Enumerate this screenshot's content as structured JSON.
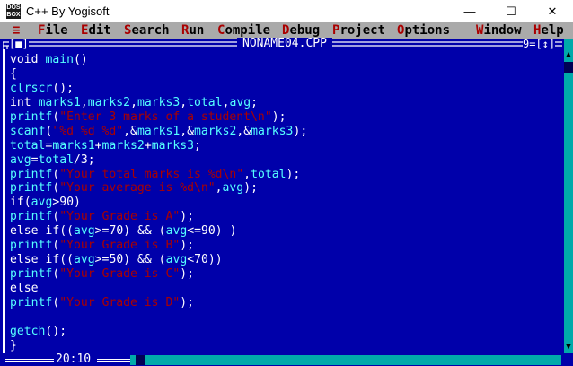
{
  "window": {
    "title": "C++ By Yogisoft",
    "icon_text": "DOS BOX",
    "minimize": "—",
    "maximize": "☐",
    "close": "✕"
  },
  "menu": {
    "system": "≡",
    "items": [
      {
        "label": "File",
        "hotkey": "F",
        "rest": "ile"
      },
      {
        "label": "Edit",
        "hotkey": "E",
        "rest": "dit"
      },
      {
        "label": "Search",
        "hotkey": "S",
        "rest": "earch"
      },
      {
        "label": "Run",
        "hotkey": "R",
        "rest": "un"
      },
      {
        "label": "Compile",
        "hotkey": "C",
        "rest": "ompile"
      },
      {
        "label": "Debug",
        "hotkey": "D",
        "rest": "ebug"
      },
      {
        "label": "Project",
        "hotkey": "P",
        "rest": "roject"
      },
      {
        "label": "Options",
        "hotkey": "O",
        "rest": "ptions"
      },
      {
        "label": "Window",
        "hotkey": "W",
        "rest": "indow"
      },
      {
        "label": "Help",
        "hotkey": "H",
        "rest": "elp"
      }
    ]
  },
  "editor": {
    "filename": "NONAME04.CPP",
    "close_box": "[■]",
    "window_number": "9",
    "zoom_box": "[↕]",
    "cursor_position": "20:10",
    "code_lines": [
      "void main()",
      "{",
      "clrscr();",
      "int marks1,marks2,marks3,total,avg;",
      "printf(\"Enter 3 marks of a student\\n\");",
      "scanf(\"%d %d %d\",&marks1,&marks2,&marks3);",
      "total=marks1+marks2+marks3;",
      "avg=total/3;",
      "printf(\"Your total marks is %d\\n\",total);",
      "printf(\"Your average is %d\\n\",avg);",
      "if(avg>90)",
      "printf(\"Your Grade is A\");",
      "else if((avg>=70) && (avg<=90) )",
      "printf(\"Your Grade is B\");",
      "else if((avg>=50) && (avg<70))",
      "printf(\"Your Grade is C\");",
      "else",
      "printf(\"Your Grade is D\");",
      "",
      "getch();",
      "}"
    ]
  },
  "colors": {
    "background": "#0000aa",
    "code_default": "#ffff55",
    "identifier": "#55ffff",
    "string": "#aa0000",
    "symbol": "#ffffff",
    "menubar": "#aaaaaa",
    "scrollbar": "#00aaaa"
  }
}
